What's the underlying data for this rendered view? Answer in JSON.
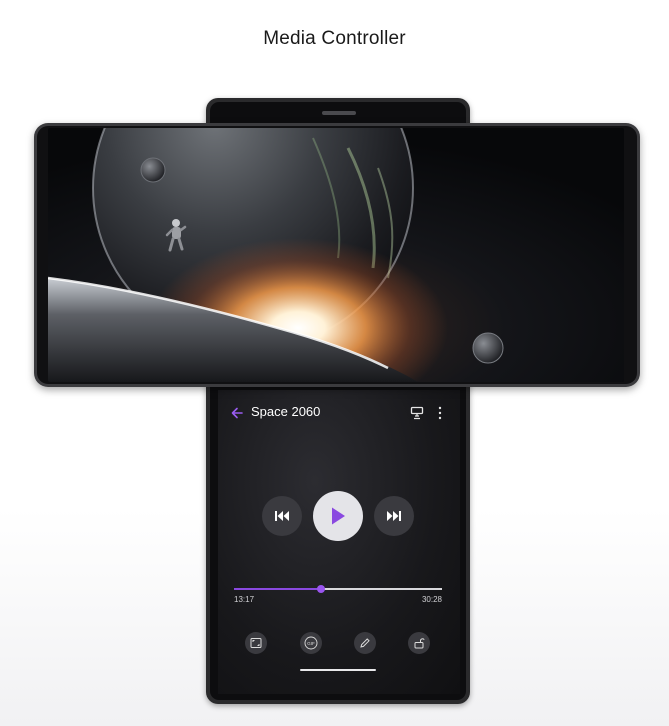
{
  "page_title": "Media Controller",
  "media_controller": {
    "title": "Space 2060",
    "elapsed_time": "13:17",
    "total_time": "30:28",
    "progress_fraction": 0.42,
    "accent_color": "#8a49e0"
  },
  "icons": {
    "back": "arrow-left-icon",
    "cast": "cast-icon",
    "more": "more-vertical-icon",
    "previous": "skip-previous-icon",
    "play": "play-icon",
    "next": "skip-next-icon",
    "fullscreen": "aspect-ratio-icon",
    "gif": "gif-icon",
    "edit": "pencil-icon",
    "lock": "unlock-icon"
  },
  "tools": [
    "aspect-ratio",
    "gif",
    "edit",
    "lock"
  ]
}
